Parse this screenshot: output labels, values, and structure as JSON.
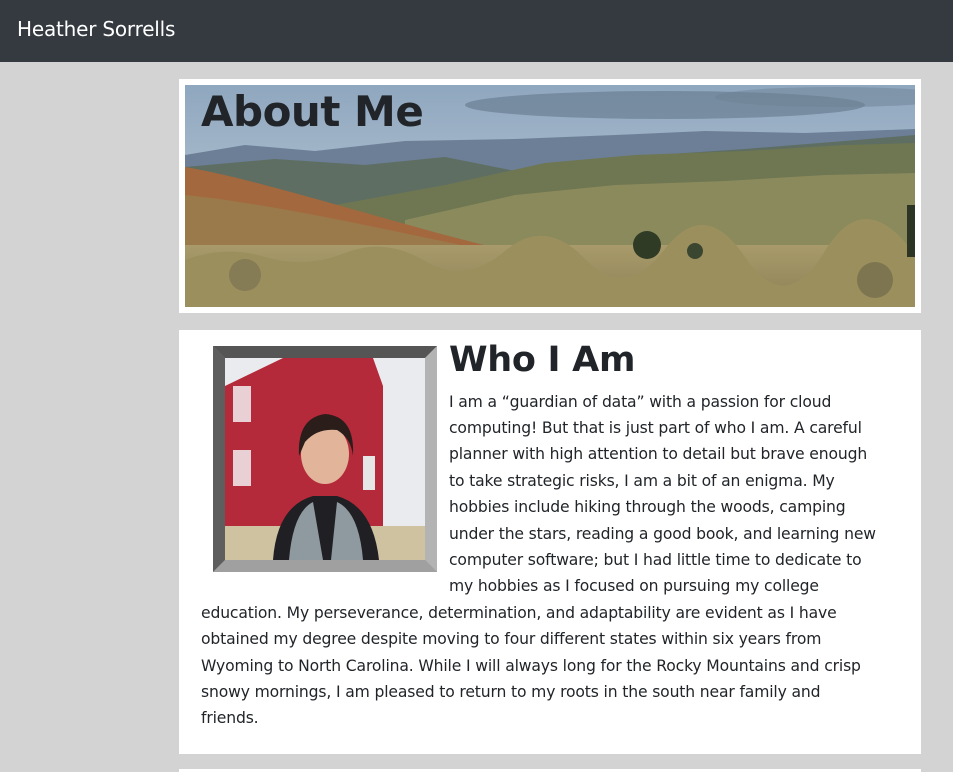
{
  "navbar": {
    "brand": "Heather Sorrells"
  },
  "hero": {
    "title": "About Me"
  },
  "about": {
    "heading": "Who I Am",
    "lines": [
      "I am a “guardian of data” with a passion for cloud",
      "computing! But that is just part of who I am. A careful",
      "planner with high attention to detail but brave enough",
      "to take strategic risks, I am a bit of an enigma. My",
      "hobbies include hiking through the woods, camping",
      "under the stars, reading a good book, and learning new",
      "computer software; but I had little time to dedicate to",
      "my hobbies as I focused on pursuing my college",
      "education. My perseverance, determination, and adaptability are evident as I have",
      "obtained my degree despite moving to four different states within six years from",
      "Wyoming to North Carolina. While I will always long for the Rocky Mountains and crisp",
      "snowy mornings, I am pleased to return to my roots in the south near family and",
      "friends."
    ]
  },
  "colors": {
    "navbar": "#343a40",
    "page_background": "#d3d3d3",
    "card_background": "#ffffff",
    "text": "#212529"
  }
}
